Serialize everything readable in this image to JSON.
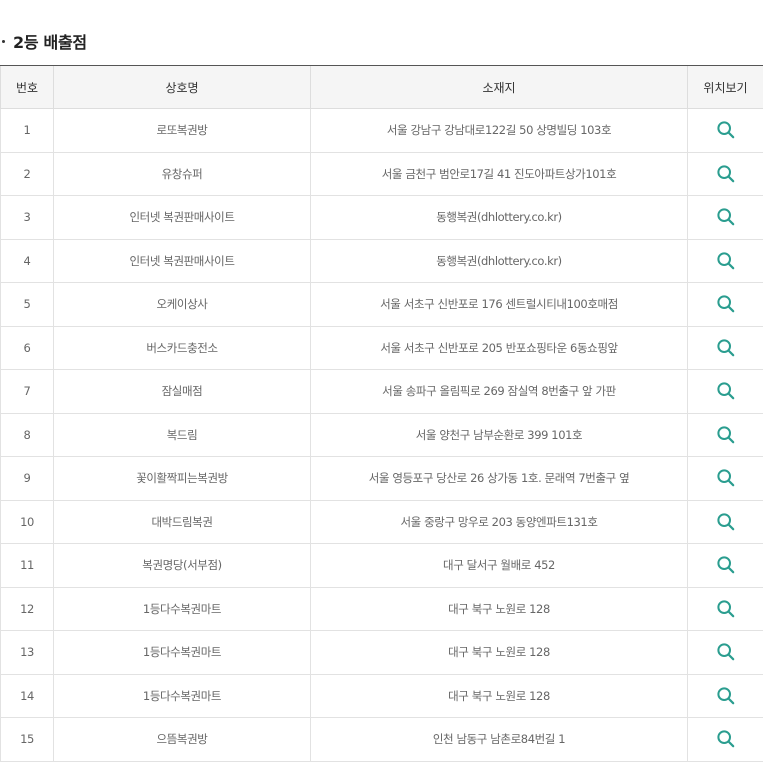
{
  "section": {
    "title": "2등 배출점"
  },
  "table": {
    "headers": {
      "no": "번호",
      "name": "상호명",
      "address": "소재지",
      "location": "위치보기"
    },
    "rows": [
      {
        "no": "1",
        "name": "로또복권방",
        "address": "서울 강남구 강남대로122길 50 상명빌딩 103호"
      },
      {
        "no": "2",
        "name": "유창슈퍼",
        "address": "서울 금천구 범안로17길 41 진도아파트상가101호"
      },
      {
        "no": "3",
        "name": "인터넷 복권판매사이트",
        "address": "동행복권(dhlottery.co.kr)"
      },
      {
        "no": "4",
        "name": "인터넷 복권판매사이트",
        "address": "동행복권(dhlottery.co.kr)"
      },
      {
        "no": "5",
        "name": "오케이상사",
        "address": "서울 서초구 신반포로 176 센트럴시티내100호매점"
      },
      {
        "no": "6",
        "name": "버스카드충전소",
        "address": "서울 서초구 신반포로 205 반포쇼핑타운 6동쇼핑앞"
      },
      {
        "no": "7",
        "name": "잠실매점",
        "address": "서울 송파구 올림픽로 269 잠실역 8번출구 앞 가판"
      },
      {
        "no": "8",
        "name": "복드림",
        "address": "서울 양천구 남부순환로 399 101호"
      },
      {
        "no": "9",
        "name": "꽃이활짝피는복권방",
        "address": "서울 영등포구 당산로 26 상가동 1호. 문래역 7번출구 옆"
      },
      {
        "no": "10",
        "name": "대박드림복권",
        "address": "서울 중랑구 망우로 203 동양엔파트131호"
      },
      {
        "no": "11",
        "name": "복권명당(서부점)",
        "address": "대구 달서구 월배로 452"
      },
      {
        "no": "12",
        "name": "1등다수복권마트",
        "address": "대구 북구 노원로 128"
      },
      {
        "no": "13",
        "name": "1등다수복권마트",
        "address": "대구 북구 노원로 128"
      },
      {
        "no": "14",
        "name": "1등다수복권마트",
        "address": "대구 북구 노원로 128"
      },
      {
        "no": "15",
        "name": "으뜸복권방",
        "address": "인천 남동구 남촌로84번길 1"
      }
    ]
  },
  "icons": {
    "location": "search-icon"
  },
  "colors": {
    "icon": "#2a9d8f",
    "header_bg": "#f5f5f5",
    "header_top_border": "#555555",
    "row_border": "#e2e2e2"
  }
}
